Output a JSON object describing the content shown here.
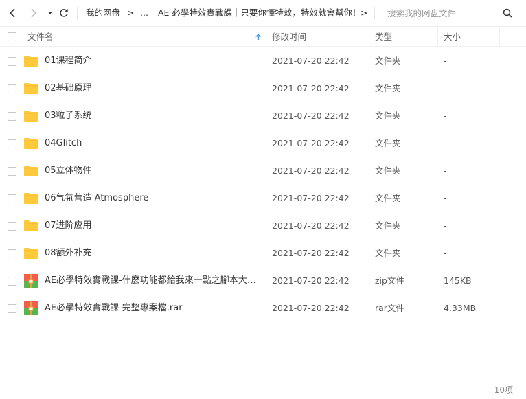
{
  "toolbar": {
    "breadcrumb_root": "我的网盘",
    "breadcrumb_sep": ">",
    "breadcrumb_ellipsis": "...",
    "breadcrumb_current": "AE 必學特效實戰課｜只要你懂特效，特效就會幫你！",
    "breadcrumb_more": ">",
    "search_placeholder": "搜索我的网盘文件"
  },
  "header": {
    "name": "文件名",
    "modified": "修改时间",
    "type": "类型",
    "size": "大小"
  },
  "rows": [
    {
      "name": "01课程简介",
      "time": "2021-07-20 22:42",
      "type": "文件夹",
      "size": "-",
      "icon": "folder-icon"
    },
    {
      "name": "02基础原理",
      "time": "2021-07-20 22:42",
      "type": "文件夹",
      "size": "-",
      "icon": "folder-icon"
    },
    {
      "name": "03粒子系统",
      "time": "2021-07-20 22:42",
      "type": "文件夹",
      "size": "-",
      "icon": "folder-icon"
    },
    {
      "name": "04Glitch",
      "time": "2021-07-20 22:42",
      "type": "文件夹",
      "size": "-",
      "icon": "folder-icon"
    },
    {
      "name": "05立体物件",
      "time": "2021-07-20 22:42",
      "type": "文件夹",
      "size": "-",
      "icon": "folder-icon"
    },
    {
      "name": "06气氛营造 Atmosphere",
      "time": "2021-07-20 22:42",
      "type": "文件夹",
      "size": "-",
      "icon": "folder-icon"
    },
    {
      "name": "07进阶应用",
      "time": "2021-07-20 22:42",
      "type": "文件夹",
      "size": "-",
      "icon": "folder-icon"
    },
    {
      "name": "08额外补充",
      "time": "2021-07-20 22:42",
      "type": "文件夹",
      "size": "-",
      "icon": "folder-icon"
    },
    {
      "name": "AE必學特效實戰課-什麼功能都給我來一點之腳本大全套....",
      "time": "2021-07-20 22:42",
      "type": "zip文件",
      "size": "145KB",
      "icon": "archive-icon"
    },
    {
      "name": "AE必學特效實戰課-完整專案檔.rar",
      "time": "2021-07-20 22:42",
      "type": "rar文件",
      "size": "4.33MB",
      "icon": "archive-icon"
    }
  ],
  "footer": {
    "count": "10项"
  },
  "colors": {
    "folder": "#ffc93c",
    "sort_arrow": "#3c9df5",
    "archive_top": "#f35e4b",
    "archive_bottom": "#57b54f",
    "archive_zip": "#e8a33c"
  }
}
